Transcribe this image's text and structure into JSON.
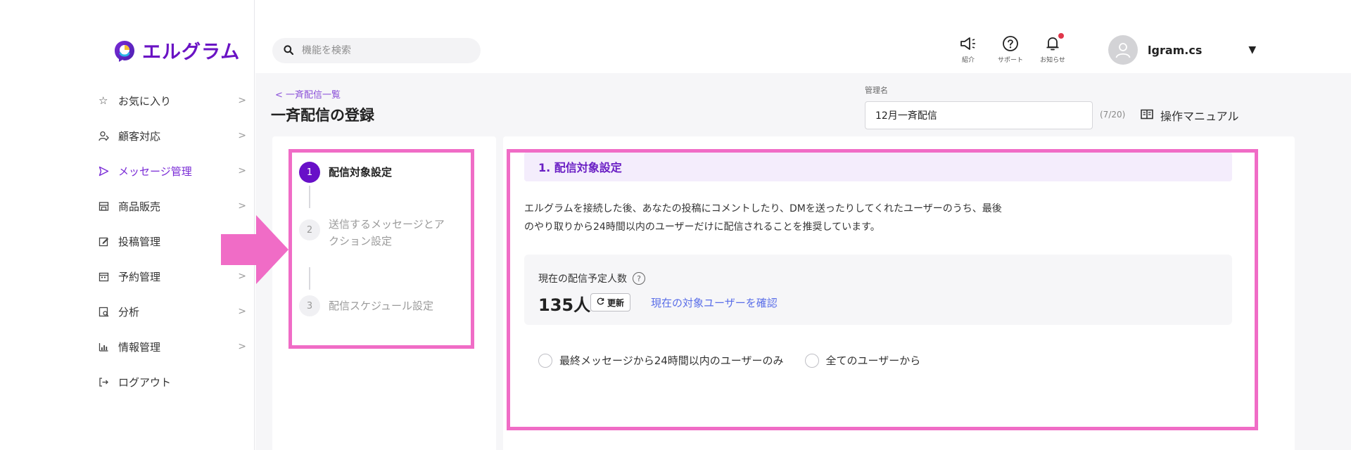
{
  "app": {
    "logo_text": "エルグラム",
    "brand_color": "#6a13c4",
    "highlight_color": "#f06cc6"
  },
  "sidebar": {
    "items": [
      {
        "label": "お気に入り",
        "icon": "star-icon"
      },
      {
        "label": "顧客対応",
        "icon": "user-icon"
      },
      {
        "label": "メッセージ管理",
        "icon": "send-icon",
        "active": true
      },
      {
        "label": "商品販売",
        "icon": "store-icon"
      },
      {
        "label": "投稿管理",
        "icon": "edit-icon"
      },
      {
        "label": "予約管理",
        "icon": "calendar-icon"
      },
      {
        "label": "分析",
        "icon": "analytics-icon"
      },
      {
        "label": "情報管理",
        "icon": "chart-icon"
      },
      {
        "label": "ログアウト",
        "icon": "logout-icon"
      }
    ],
    "chevron": ">"
  },
  "header": {
    "search_placeholder": "機能を検索",
    "intro_label": "紹介",
    "support_label": "サポート",
    "notice_label": "お知らせ",
    "username": "lgram.cs"
  },
  "main": {
    "breadcrumb": "< 一斉配信一覧",
    "title": "一斉配信の登録",
    "mgmt_name_label": "管理名",
    "mgmt_name_value": "12月一斉配信",
    "mgmt_name_count": "(7/20)",
    "manual_label": "操作マニュアル"
  },
  "steps": [
    {
      "num": "1",
      "label": "配信対象設定",
      "active": true
    },
    {
      "num": "2",
      "label": "送信するメッセージとアクション設定",
      "active": false
    },
    {
      "num": "3",
      "label": "配信スケジュール設定",
      "active": false
    }
  ],
  "section": {
    "title": "1. 配信対象設定",
    "description_line1": "エルグラムを接続した後、あなたの投稿にコメントしたり、DMを送ったりしてくれたユーザーのうち、最後",
    "description_line2": "のやり取りから24時間以内のユーザーだけに配信されることを推奨しています。",
    "count_label": "現在の配信予定人数",
    "count_value": "135人",
    "refresh_label": "更新",
    "check_users_link": "現在の対象ユーザーを確認",
    "radio_options": [
      "最終メッセージから24時間以内のユーザーのみ",
      "全てのユーザーから"
    ]
  }
}
